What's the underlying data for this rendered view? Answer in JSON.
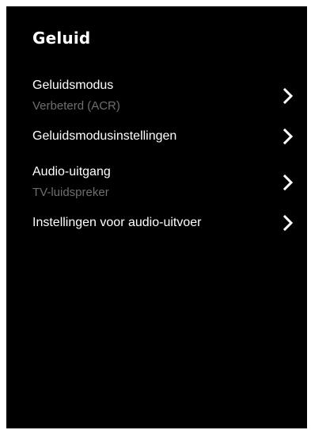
{
  "panel": {
    "title": "Geluid"
  },
  "menu": {
    "items": [
      {
        "label": "Geluidsmodus",
        "value": "Verbeterd (ACR)",
        "icon": "chevron-right-icon"
      },
      {
        "label": "Geluidsmodusinstellingen",
        "icon": "chevron-right-icon"
      },
      {
        "label": "Audio-uitgang",
        "value": "TV-luidspreker",
        "icon": "chevron-right-icon"
      },
      {
        "label": "Instellingen voor audio-uitvoer",
        "icon": "chevron-right-icon"
      }
    ]
  },
  "colors": {
    "background": "#000000",
    "text": "#ffffff",
    "secondary_text": "#6e6e6e"
  }
}
